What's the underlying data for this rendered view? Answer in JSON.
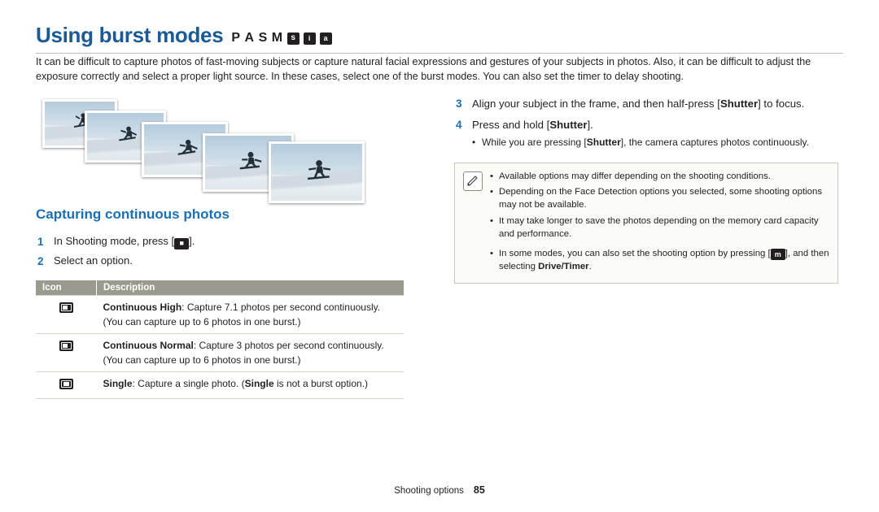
{
  "header": {
    "title": "Using burst modes",
    "mode_icons": [
      "P",
      "A",
      "S",
      "M",
      "s-icon",
      "smart-icon",
      "auto-icon"
    ],
    "mode_labels": {
      "p": "P",
      "a": "A",
      "s": "S",
      "m": "M",
      "s_box": "s",
      "smart_box": "i",
      "auto_box": "a"
    }
  },
  "intro": "It can be difficult to capture photos of fast-moving subjects or capture natural facial expressions and gestures of your subjects in photos. Also, it can be difficult to adjust the exposure correctly and select a proper light source. In these cases, select one of the burst modes. You can also set the timer to delay shooting.",
  "left": {
    "section_title": "Capturing continuous photos",
    "steps": [
      {
        "num": "1",
        "pre": "In Shooting mode, press [",
        "icon": "burst-icon",
        "post": "]."
      },
      {
        "num": "2",
        "text": "Select an option."
      }
    ],
    "table": {
      "headers": [
        "Icon",
        "Description"
      ],
      "rows": [
        {
          "icon": "continuous-high-icon",
          "label": "Continuous High",
          "desc": ": Capture 7.1 photos per second continuously.",
          "note": "(You can capture up to 6 photos in one burst.)"
        },
        {
          "icon": "continuous-normal-icon",
          "label": "Continuous Normal",
          "desc": ": Capture 3 photos per second continuously.",
          "note": "(You can capture up to 6 photos in one burst.)"
        },
        {
          "icon": "single-icon",
          "label": "Single",
          "desc": ": Capture a single photo. (",
          "label2": "Single",
          "desc2": " is not a burst option.)",
          "note": ""
        }
      ]
    }
  },
  "right": {
    "steps": [
      {
        "num": "3",
        "part1": "Align your subject in the frame, and then half-press [",
        "bold": "Shutter",
        "part2": "] to focus."
      },
      {
        "num": "4",
        "part1": "Press and hold [",
        "bold": "Shutter",
        "part2": "]."
      }
    ],
    "sub_bullet": {
      "part1": "While you are pressing [",
      "bold": "Shutter",
      "part2": "], the camera captures photos continuously."
    },
    "note": {
      "icon": "note-pencil-icon",
      "items": [
        {
          "text": "Available options may differ depending on the shooting conditions."
        },
        {
          "text": "Depending on the Face Detection options you selected, some shooting options may not be available."
        },
        {
          "text": "It may take longer to save the photos depending on the memory card capacity and performance."
        },
        {
          "part1": "In some modes, you can also set the shooting option by pressing [",
          "menu_icon": "m",
          "part2": "], and then selecting ",
          "bold": "Drive/Timer",
          "part3": "."
        }
      ]
    }
  },
  "footer": {
    "label": "Shooting options",
    "page": "85"
  },
  "colors": {
    "heading_blue": "#1a5a96",
    "section_blue": "#1a6fb5",
    "table_header_bg": "#9a9a8e",
    "note_border": "#c8c8bc"
  }
}
